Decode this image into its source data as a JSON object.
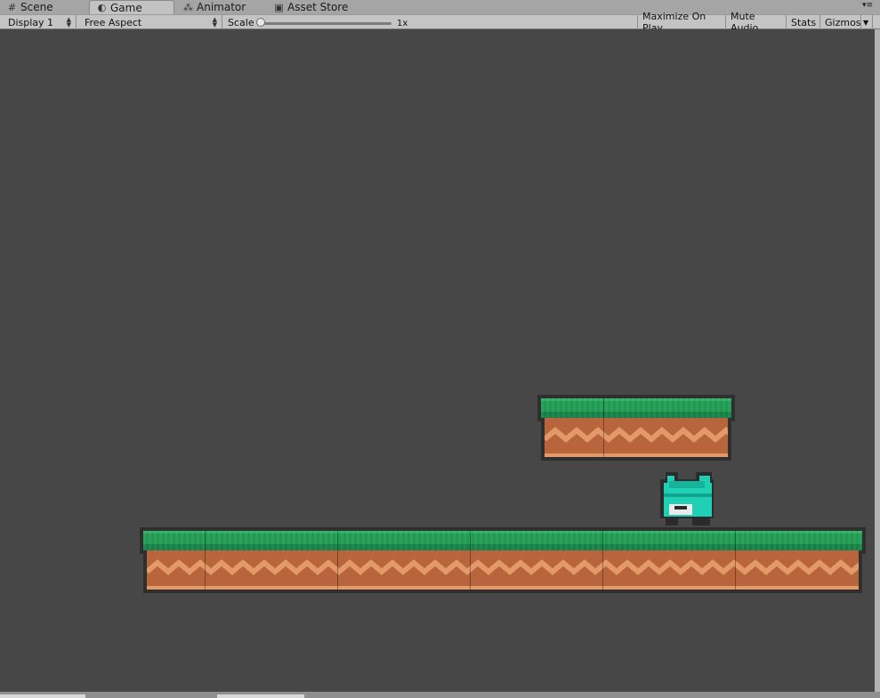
{
  "tabs": [
    {
      "label": "Scene",
      "icon": "grid-icon",
      "active": false
    },
    {
      "label": "Game",
      "icon": "pacman-icon",
      "active": true
    },
    {
      "label": "Animator",
      "icon": "animator-icon",
      "active": false
    },
    {
      "label": "Asset Store",
      "icon": "store-bag-icon",
      "active": false
    }
  ],
  "toolbar": {
    "display": "Display 1",
    "aspect": "Free Aspect",
    "scale_label": "Scale",
    "scale_value": "1x",
    "scale_fraction": 0.0,
    "maximize": "Maximize On Play",
    "mute": "Mute Audio",
    "stats": "Stats",
    "gizmos": "Gizmos"
  },
  "scene": {
    "background_color": "#474747",
    "grass_color": "#209a53",
    "dirt_color": "#b8653e",
    "dirt_pattern_color": "#e39a68",
    "player_color": "#1fd0b4"
  }
}
